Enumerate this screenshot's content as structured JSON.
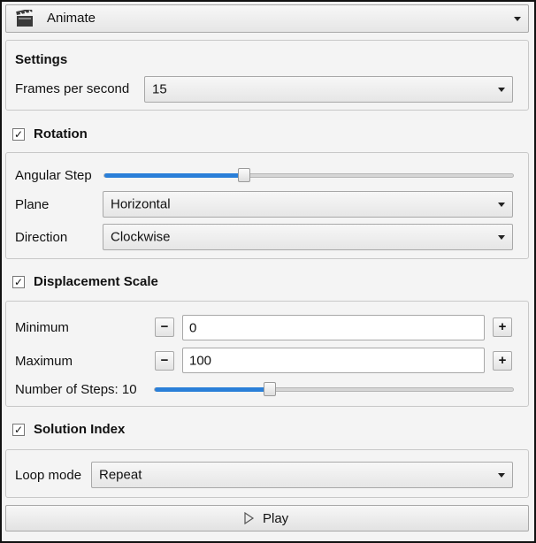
{
  "header": {
    "title": "Animate",
    "icon": "clapperboard-icon"
  },
  "settings": {
    "heading": "Settings",
    "fps_label": "Frames per second",
    "fps_value": "15"
  },
  "rotation": {
    "label": "Rotation",
    "checked": true,
    "angular_step_label": "Angular Step",
    "angular_step_fraction": 0.34,
    "plane_label": "Plane",
    "plane_value": "Horizontal",
    "direction_label": "Direction",
    "direction_value": "Clockwise"
  },
  "displacement": {
    "label": "Displacement Scale",
    "checked": true,
    "minimum_label": "Minimum",
    "minimum_value": "0",
    "maximum_label": "Maximum",
    "maximum_value": "100",
    "steps_label": "Number of Steps: 10",
    "steps_fraction": 0.32,
    "minus": "−",
    "plus": "+"
  },
  "solution": {
    "label": "Solution Index",
    "checked": true,
    "loop_label": "Loop mode",
    "loop_value": "Repeat"
  },
  "play": {
    "label": "Play",
    "icon": "play-icon"
  },
  "colors": {
    "accent": "#2a7fd8",
    "panel": "#f4f4f4"
  }
}
